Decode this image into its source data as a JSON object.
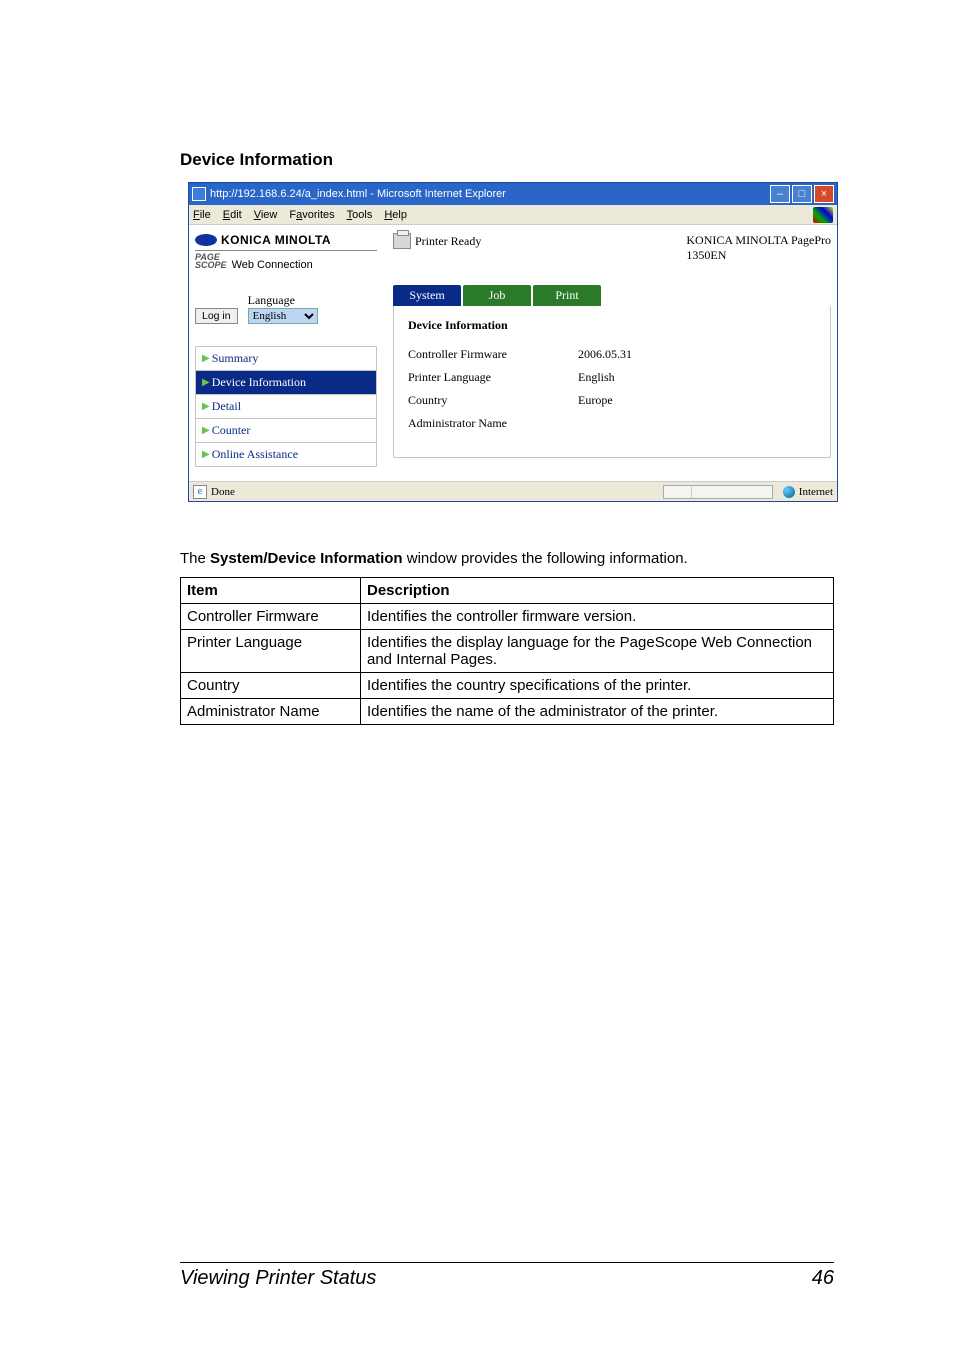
{
  "heading": "Device Information",
  "screenshot": {
    "title": "http://192.168.6.24/a_index.html - Microsoft Internet Explorer",
    "menus": [
      "File",
      "Edit",
      "View",
      "Favorites",
      "Tools",
      "Help"
    ],
    "menus_accel_idx": [
      0,
      0,
      0,
      1,
      0,
      0
    ],
    "brand": "KONICA MINOLTA",
    "subbrand": "Web Connection",
    "login_label": "Log in",
    "language_label": "Language",
    "language_value": "English",
    "printer_status": "Printer Ready",
    "model_line1": "KONICA MINOLTA PagePro",
    "model_line2": "1350EN",
    "tabs": [
      "System",
      "Job",
      "Print"
    ],
    "nav": [
      "Summary",
      "Device Information",
      "Detail",
      "Counter",
      "Online Assistance"
    ],
    "nav_active_index": 1,
    "panel_title": "Device Information",
    "kv": [
      {
        "k": "Controller Firmware",
        "v": "2006.05.31"
      },
      {
        "k": "Printer Language",
        "v": "English"
      },
      {
        "k": "Country",
        "v": "Europe"
      },
      {
        "k": "Administrator Name",
        "v": ""
      }
    ],
    "status_done": "Done",
    "status_zone": "Internet"
  },
  "caption_pre": "The ",
  "caption_bold": "System/Device Information",
  "caption_post": " window provides the following information.",
  "table": {
    "headers": [
      "Item",
      "Description"
    ],
    "rows": [
      {
        "item": "Controller Firmware",
        "desc": "Identifies the controller firmware version."
      },
      {
        "item": "Printer Language",
        "desc": "Identifies the display language for the PageScope Web Connection and Internal Pages."
      },
      {
        "item": "Country",
        "desc": "Identifies the country specifications of the printer."
      },
      {
        "item": "Administrator Name",
        "desc": "Identifies the name of the administrator of the printer."
      }
    ]
  },
  "footer_left": "Viewing Printer Status",
  "footer_right": "46"
}
